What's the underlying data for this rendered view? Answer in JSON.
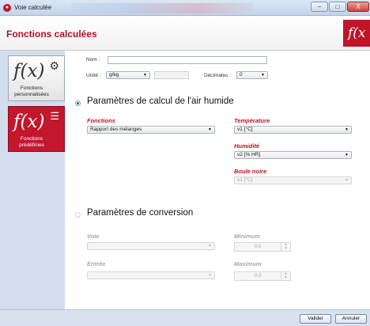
{
  "window": {
    "title": "Voie calculée",
    "icon": "app-icon",
    "controls": {
      "minimize": "–",
      "maximize": "□",
      "close": "X"
    }
  },
  "header": {
    "title": "Fonctions calculées",
    "logo_text": "f(x",
    "brand_color": "#c0142a"
  },
  "sidebar": {
    "items": [
      {
        "glyph": "f(x)",
        "icon": "gear-icon",
        "label_line1": "Fonctions",
        "label_line2": "personnalisées",
        "active": false
      },
      {
        "glyph": "f(x)",
        "icon": "list-icon",
        "label_line1": "Fonctions",
        "label_line2": "prédéfinies",
        "active": true
      }
    ]
  },
  "form": {
    "name_label": "Nom :",
    "name_value": "",
    "unit_label": "Unité :",
    "unit_value": "g/kg",
    "unit_extra": "",
    "decimals_label": "Décimales :",
    "decimals_value": "0"
  },
  "humid_section": {
    "selected": true,
    "title": "Paramètres de calcul de l'air humide",
    "functions_label": "Fonctions",
    "functions_value": "Rapport des mélanges",
    "temperature_label": "Température",
    "temperature_value": "v1 [°C]",
    "humidity_label": "Humidité",
    "humidity_value": "v2 [% HR]",
    "black_bulb_label": "Boule noire",
    "black_bulb_value": "v1 [°C]"
  },
  "conversion_section": {
    "selected": false,
    "title": "Paramètres de conversion",
    "channel_label": "Voie",
    "channel_value": "",
    "input_label": "Entrée",
    "input_value": "",
    "minimum_label": "Minimum",
    "minimum_value": "0,0",
    "maximum_label": "Maximum",
    "maximum_value": "0,0"
  },
  "footer": {
    "validate_label": "Valider",
    "cancel_label": "Annuler"
  }
}
